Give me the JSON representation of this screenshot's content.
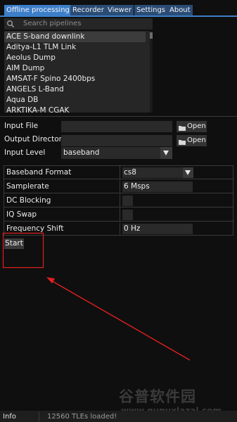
{
  "tabs": [
    {
      "label": "Offline processing",
      "active": true
    },
    {
      "label": "Recorder",
      "active": false
    },
    {
      "label": "Viewer",
      "active": false
    },
    {
      "label": "Settings",
      "active": false
    },
    {
      "label": "About",
      "active": false
    }
  ],
  "search": {
    "placeholder": "Search pipelines",
    "icon": "search-icon"
  },
  "pipelines": {
    "items": [
      "ACE S-band downlink",
      "Aditya-L1 TLM Link",
      "Aeolus Dump",
      "AIM Dump",
      "AMSAT-F Spino 2400bps",
      "ANGELS L-Band",
      "Aqua DB",
      "ARKTIKA-M CGAK"
    ],
    "selected": "ACE S-band downlink"
  },
  "io": {
    "input_file_label": "Input File",
    "output_dir_label": "Output Directory",
    "input_level_label": "Input Level",
    "open_label": "Open",
    "input_file_value": "",
    "output_dir_value": "",
    "input_level_value": "baseband"
  },
  "options": {
    "baseband_format_label": "Baseband Format",
    "baseband_format_value": "cs8",
    "samplerate_label": "Samplerate",
    "samplerate_value": "6 Msps",
    "dc_blocking_label": "DC Blocking",
    "dc_blocking_checked": false,
    "iq_swap_label": "IQ Swap",
    "iq_swap_checked": false,
    "frequency_shift_label": "Frequency Shift",
    "frequency_shift_value": "0 Hz"
  },
  "start_label": "Start",
  "status": {
    "left": "Info",
    "message": "12560 TLEs loaded!"
  },
  "watermark": {
    "text": "谷普软件园",
    "url": "www.gupuxlazal.com"
  },
  "colors": {
    "active_tab": "#3d7ec9",
    "inactive_tab": "#2a4c75",
    "background": "#0f0f0f",
    "annotation": "#e02020"
  }
}
